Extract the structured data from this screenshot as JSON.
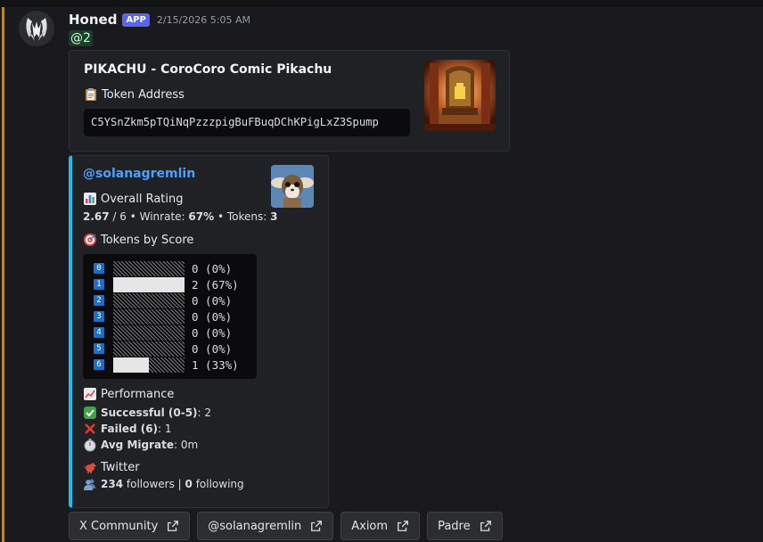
{
  "message": {
    "author": "Honed",
    "badge": "APP",
    "timestamp": "2/15/2026 5:05 AM",
    "mention": "@2"
  },
  "embed1": {
    "title": "PIKACHU - CoroCoro Comic Pikachu",
    "field_name": "Token Address",
    "field_icon": "clipboard-icon",
    "token_address": "C5YSnZkm5pTQiNqPzzzpigBuFBuqDChKPigLxZ3Spump"
  },
  "embed2": {
    "accent_color": "#1bbfe8",
    "author_handle": "@solanagremlin",
    "overall_rating_label": "Overall Rating",
    "rating_value": "2.67",
    "rating_max": " / 6 • Winrate: ",
    "winrate": "67%",
    "tokens_label": " • Tokens: ",
    "tokens": "3",
    "tokens_by_score_label": "Tokens by Score",
    "score_rows": [
      {
        "score": "0",
        "count": 0,
        "label": "0 (0%)",
        "fraction": 0
      },
      {
        "score": "1",
        "count": 2,
        "label": "2 (67%)",
        "fraction": 1
      },
      {
        "score": "2",
        "count": 0,
        "label": "0 (0%)",
        "fraction": 0
      },
      {
        "score": "3",
        "count": 0,
        "label": "0 (0%)",
        "fraction": 0
      },
      {
        "score": "4",
        "count": 0,
        "label": "0 (0%)",
        "fraction": 0
      },
      {
        "score": "5",
        "count": 0,
        "label": "0 (0%)",
        "fraction": 0
      },
      {
        "score": "6",
        "count": 1,
        "label": "1 (33%)",
        "fraction": 0.5
      }
    ],
    "performance_label": "Performance",
    "successful_label": "Successful (0-5)",
    "successful_value": ": 2",
    "failed_label": "Failed (6)",
    "failed_value": ": 1",
    "avg_migrate_label": "Avg Migrate",
    "avg_migrate_value": ": 0m",
    "twitter_label": "Twitter",
    "followers": "234",
    "followers_text": " followers | ",
    "following": "0",
    "following_text": " following"
  },
  "buttons": [
    {
      "label": "X Community"
    },
    {
      "label": "@solanagremlin"
    },
    {
      "label": "Axiom"
    },
    {
      "label": "Padre"
    }
  ]
}
